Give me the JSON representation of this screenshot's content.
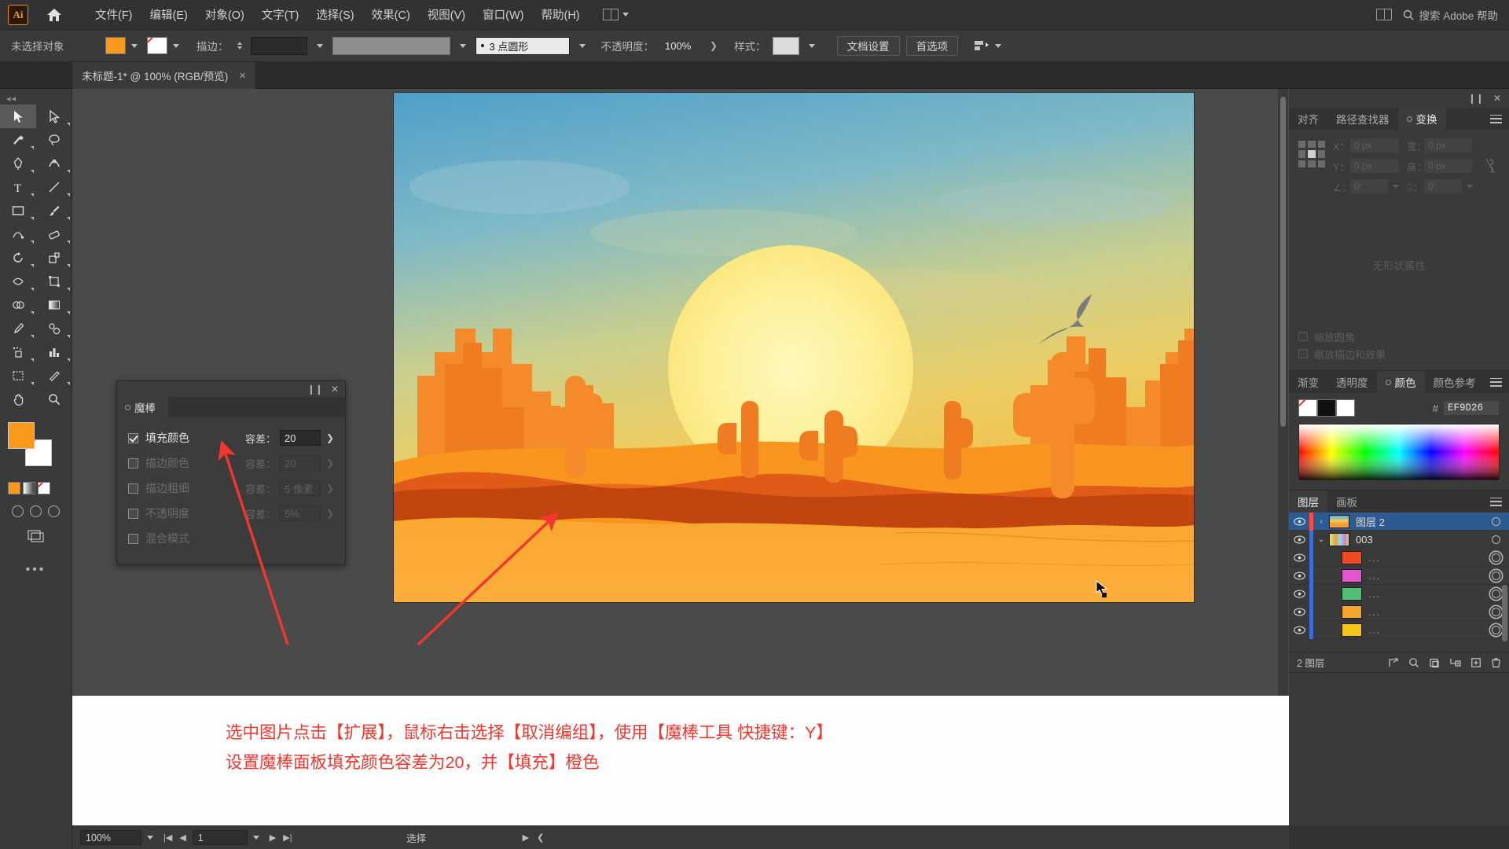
{
  "app": {
    "logo": "Ai",
    "home_icon": "home-icon"
  },
  "menubar": {
    "items": [
      {
        "label": "文件(F)"
      },
      {
        "label": "编辑(E)"
      },
      {
        "label": "对象(O)"
      },
      {
        "label": "文字(T)"
      },
      {
        "label": "选择(S)"
      },
      {
        "label": "效果(C)"
      },
      {
        "label": "视图(V)"
      },
      {
        "label": "窗口(W)"
      },
      {
        "label": "帮助(H)"
      }
    ],
    "search_placeholder": "搜索 Adobe 帮助"
  },
  "controlbar": {
    "selection_status": "未选择对象",
    "fill_color": "#F79A1E",
    "stroke_color": "none",
    "stroke_label": "描边：",
    "stroke_weight": "",
    "stroke_profile": "",
    "brush_definition": "3 点圆形",
    "opacity_label": "不透明度：",
    "opacity_value": "100%",
    "style_label": "样式：",
    "doc_setup_button": "文档设置",
    "preferences_button": "首选项"
  },
  "document_tab": {
    "title": "未标题-1* @ 100% (RGB/预览)",
    "close": "×"
  },
  "toolbar": {
    "tools": [
      {
        "name": "selection-tool",
        "selected": true
      },
      {
        "name": "direct-selection-tool",
        "selected": false
      },
      {
        "name": "magic-wand-tool",
        "selected": false
      },
      {
        "name": "lasso-tool",
        "selected": false
      },
      {
        "name": "pen-tool",
        "selected": false
      },
      {
        "name": "curvature-tool",
        "selected": false
      },
      {
        "name": "type-tool",
        "selected": false
      },
      {
        "name": "line-segment-tool",
        "selected": false
      },
      {
        "name": "rectangle-tool",
        "selected": false
      },
      {
        "name": "paintbrush-tool",
        "selected": false
      },
      {
        "name": "shaper-tool",
        "selected": false
      },
      {
        "name": "eraser-tool",
        "selected": false
      },
      {
        "name": "rotate-tool",
        "selected": false
      },
      {
        "name": "scale-tool",
        "selected": false
      },
      {
        "name": "width-tool",
        "selected": false
      },
      {
        "name": "free-transform-tool",
        "selected": false
      },
      {
        "name": "shape-builder-tool",
        "selected": false
      },
      {
        "name": "gradient-tool",
        "selected": false
      },
      {
        "name": "eyedropper-tool",
        "selected": false
      },
      {
        "name": "blend-tool",
        "selected": false
      },
      {
        "name": "symbol-sprayer-tool",
        "selected": false
      },
      {
        "name": "column-graph-tool",
        "selected": false
      },
      {
        "name": "artboard-tool",
        "selected": false
      },
      {
        "name": "slice-tool",
        "selected": false
      },
      {
        "name": "hand-tool",
        "selected": false
      },
      {
        "name": "zoom-tool",
        "selected": false
      }
    ],
    "fill_color": "#F79A1E",
    "stroke_color": "none",
    "more_tools": "•••"
  },
  "magic_wand_panel": {
    "tab_label": "魔棒",
    "collapse_icon": "collapse-icon",
    "close_icon": "close-icon",
    "rows": [
      {
        "label": "填充颜色",
        "checked": true,
        "tol_label": "容差：",
        "tol_value": "20",
        "enabled": true
      },
      {
        "label": "描边颜色",
        "checked": false,
        "tol_label": "容差：",
        "tol_value": "20",
        "enabled": false
      },
      {
        "label": "描边粗细",
        "checked": false,
        "tol_label": "容差：",
        "tol_value": "5 像素",
        "enabled": false
      },
      {
        "label": "不透明度",
        "checked": false,
        "tol_label": "容差：",
        "tol_value": "5%",
        "enabled": false
      },
      {
        "label": "混合模式",
        "checked": false,
        "tol_label": "",
        "tol_value": "",
        "enabled": false
      }
    ]
  },
  "transform_panel": {
    "tabs": [
      {
        "label": "对齐",
        "active": false
      },
      {
        "label": "路径查找器",
        "active": false
      },
      {
        "label": "变换",
        "active": true
      }
    ],
    "fields": [
      {
        "label": "X：",
        "value": "0 px"
      },
      {
        "label": "宽：",
        "value": "0 px"
      },
      {
        "label": "Y：",
        "value": "0 px"
      },
      {
        "label": "高：",
        "value": "0 px"
      }
    ],
    "angle_label": "∠：",
    "angle_value": "0°",
    "shear_label": "⌺：",
    "shear_value": "0°",
    "empty_text": "无形状属性",
    "checkboxes": [
      {
        "label": "缩放圆角",
        "checked": false
      },
      {
        "label": "缩放描边和效果",
        "checked": false
      }
    ]
  },
  "color_panel": {
    "tabs": [
      {
        "label": "渐变",
        "active": false
      },
      {
        "label": "透明度",
        "active": false
      },
      {
        "label": "颜色",
        "active": true
      },
      {
        "label": "颜色参考",
        "active": false
      }
    ],
    "hash": "#",
    "hex_value": "EF9D26",
    "swatches": [
      "none",
      "#111111",
      "#FFFFFF"
    ]
  },
  "layers_panel": {
    "tabs": [
      {
        "label": "图层",
        "active": true
      },
      {
        "label": "画板",
        "active": false
      }
    ],
    "rows": [
      {
        "name": "图层 2",
        "selected": true,
        "indent": 0,
        "color": "#ff4d3a",
        "thumb": "sunset",
        "twist": "›",
        "eye": true,
        "target": "ring"
      },
      {
        "name": "003",
        "selected": false,
        "indent": 0,
        "color": "#3a6fd8",
        "thumb": "multi",
        "twist": "⌄",
        "eye": true,
        "target": "ring"
      },
      {
        "name": "...",
        "selected": false,
        "indent": 1,
        "color": "#3a6fd8",
        "thumb": "#ef4a22",
        "twist": "",
        "eye": true,
        "target": "ring2"
      },
      {
        "name": "...",
        "selected": false,
        "indent": 1,
        "color": "#3a6fd8",
        "thumb": "#e555d0",
        "twist": "",
        "eye": true,
        "target": "ring2"
      },
      {
        "name": "...",
        "selected": false,
        "indent": 1,
        "color": "#3a6fd8",
        "thumb": "#53bf72",
        "twist": "",
        "eye": true,
        "target": "ring2"
      },
      {
        "name": "...",
        "selected": false,
        "indent": 1,
        "color": "#3a6fd8",
        "thumb": "#f2a72c",
        "twist": "",
        "eye": true,
        "target": "ring2"
      },
      {
        "name": "...",
        "selected": false,
        "indent": 1,
        "color": "#3a6fd8",
        "thumb": "#f5c518",
        "twist": "",
        "eye": true,
        "target": "ring2"
      }
    ],
    "footer_count": "2 图层",
    "footer_icons": [
      "locate-object-icon",
      "search-icon",
      "make-clipping-mask-icon",
      "create-sublayer-icon",
      "new-layer-icon",
      "delete-layer-icon"
    ]
  },
  "annotation": {
    "line1": "选中图片点击【扩展】，鼠标右击选择【取消编组】，使用【魔棒工具 快捷键：Y】",
    "line2": "设置魔棒面板填充颜色容差为20，并【填充】橙色",
    "color": "#F1372F"
  },
  "statusbar": {
    "zoom": "100%",
    "page": "1",
    "status_text": "选择"
  },
  "artwork": {
    "description": "沙漠日落仙人掌插画",
    "sky_top": "#5aa3c8",
    "sky_mid": "#e8c86a",
    "sun": "#fdf6b0",
    "sand": "#f9a033",
    "mesa": "#f07a22",
    "dune_dark": "#c44a10"
  }
}
